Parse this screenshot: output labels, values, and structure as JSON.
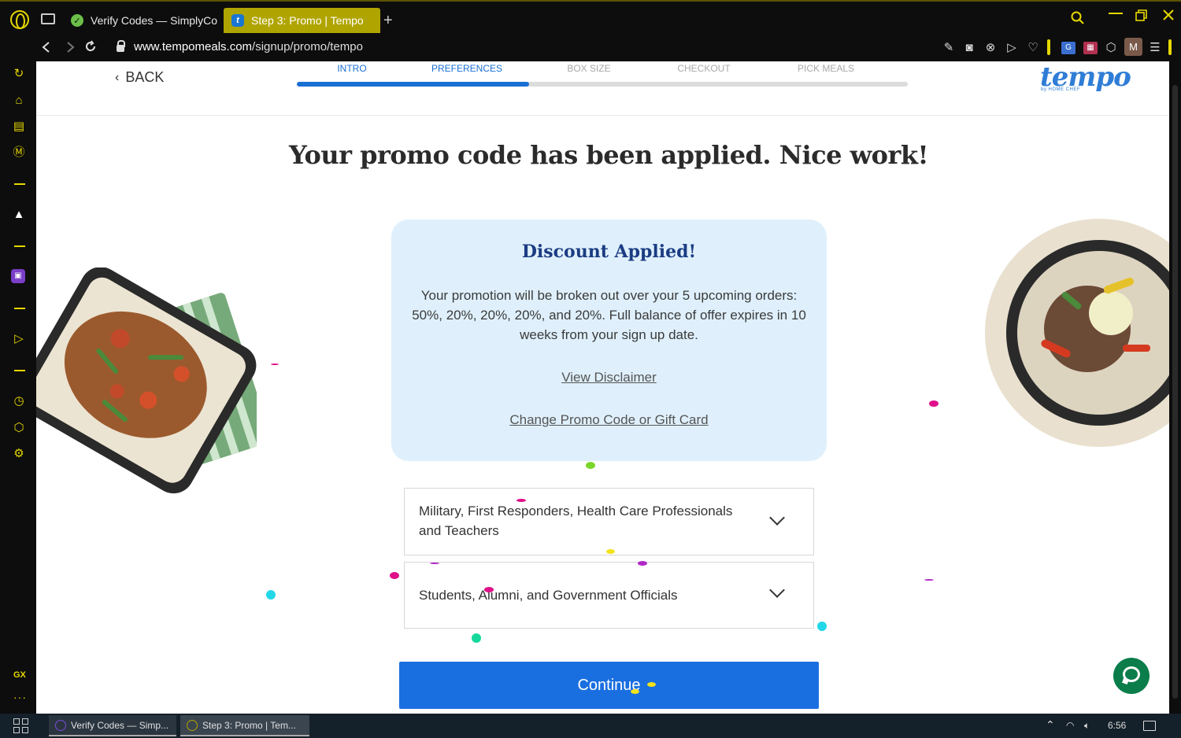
{
  "browser": {
    "tabs": [
      {
        "title": "Verify Codes — SimplyCo",
        "active": false
      },
      {
        "title": "Step 3: Promo | Tempo",
        "active": true
      }
    ],
    "url_domain": "www.tempomeals.com",
    "url_path": "/signup/promo/tempo",
    "profile_initial": "M"
  },
  "sidebar": {
    "gx_label": "GX",
    "more_label": "···"
  },
  "header": {
    "back_label": "BACK",
    "steps": [
      "INTRO",
      "PREFERENCES",
      "BOX SIZE",
      "CHECKOUT",
      "PICK MEALS"
    ],
    "completed_steps": 2,
    "progress_fraction": 0.38,
    "brand": "tempo",
    "brand_sub": "by HOME CHEF"
  },
  "main": {
    "headline": "Your promo code has been applied. Nice work!",
    "discount": {
      "title": "Discount Applied!",
      "body": "Your promotion will be broken out over your 5 upcoming orders: 50%, 20%, 20%, 20%, and 20%. Full balance of offer expires in 10 weeks from your sign up date.",
      "disclaimer_link": "View Disclaimer",
      "change_link": "Change Promo Code or Gift Card"
    },
    "accordions": [
      {
        "label": "Military, First Responders, Health Care Professionals and Teachers"
      },
      {
        "label": "Students, Alumni, and Government Officials"
      }
    ],
    "continue_label": "Continue"
  },
  "taskbar": {
    "items": [
      "Verify Codes — Simp...",
      "Step 3: Promo | Tem..."
    ],
    "time": "6:56"
  },
  "colors": {
    "accent": "#1a6fe0",
    "brand_blue": "#2f7dd6",
    "discount_bg": "#dff0fc",
    "opera_yellow": "#e6d800",
    "chat_green": "#0a7d4a"
  }
}
